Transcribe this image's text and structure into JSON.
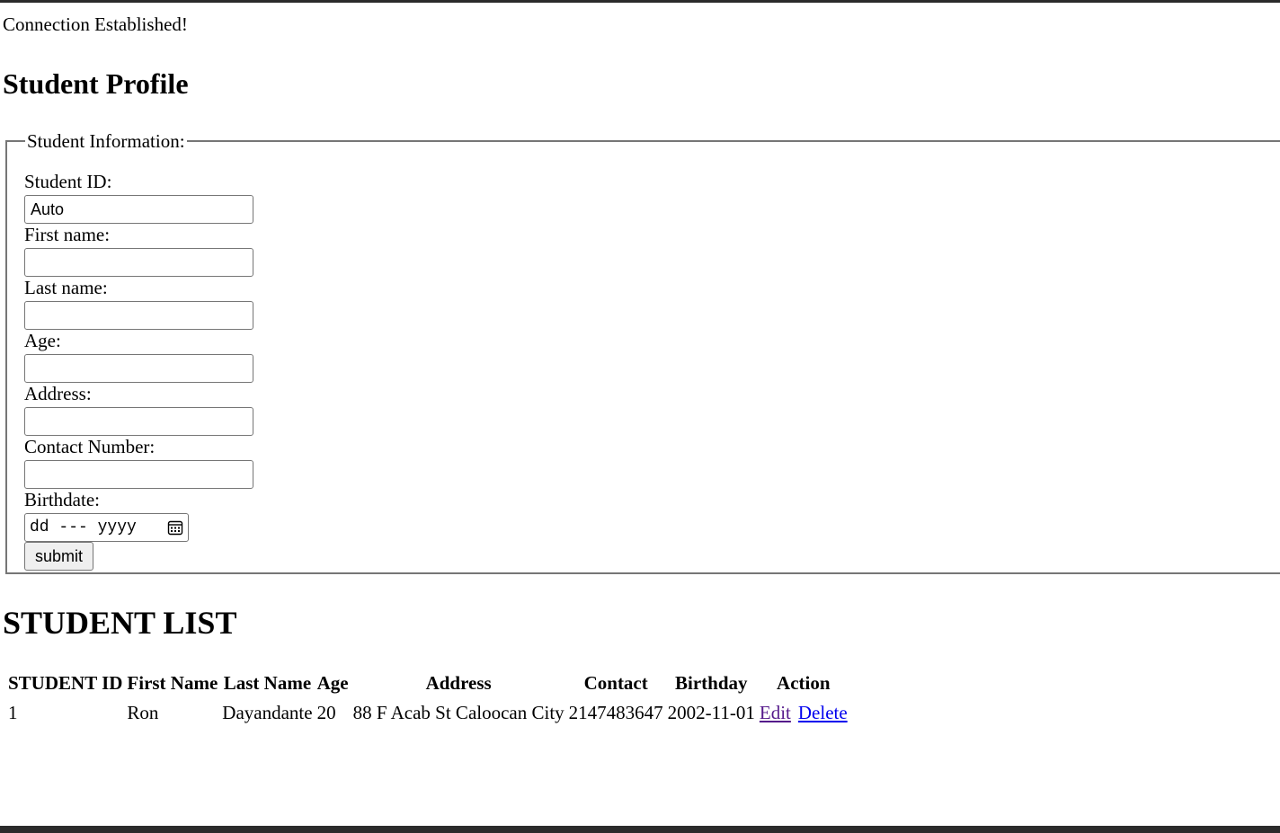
{
  "status_message": "Connection Established!",
  "page_title": "Student Profile",
  "form": {
    "legend": "Student Information:",
    "student_id_label": "Student ID:",
    "student_id_value": "Auto",
    "first_name_label": "First name:",
    "first_name_value": "",
    "last_name_label": "Last name:",
    "last_name_value": "",
    "age_label": "Age:",
    "age_value": "",
    "address_label": "Address:",
    "address_value": "",
    "contact_label": "Contact Number:",
    "contact_value": "",
    "birthdate_label": "Birthdate:",
    "birthdate_placeholder": "dd --- yyyy",
    "calendar_icon": "calendar-icon",
    "submit_label": "submit"
  },
  "list_title": "STUDENT LIST",
  "table": {
    "headers": [
      "STUDENT ID",
      "First Name",
      "Last Name",
      "Age",
      "Address",
      "Contact",
      "Birthday",
      "Action"
    ],
    "rows": [
      {
        "student_id": "1",
        "first_name": "Ron",
        "last_name": "Dayandante",
        "age": "20",
        "address": "88 F Acab St Caloocan City",
        "contact": "2147483647",
        "birthday": "2002-11-01",
        "edit_label": "Edit",
        "delete_label": "Delete"
      }
    ]
  },
  "colors": {
    "visited_link": "#551a8b",
    "link": "#0000ee",
    "border": "#767676",
    "frame": "#2b2b2b"
  }
}
